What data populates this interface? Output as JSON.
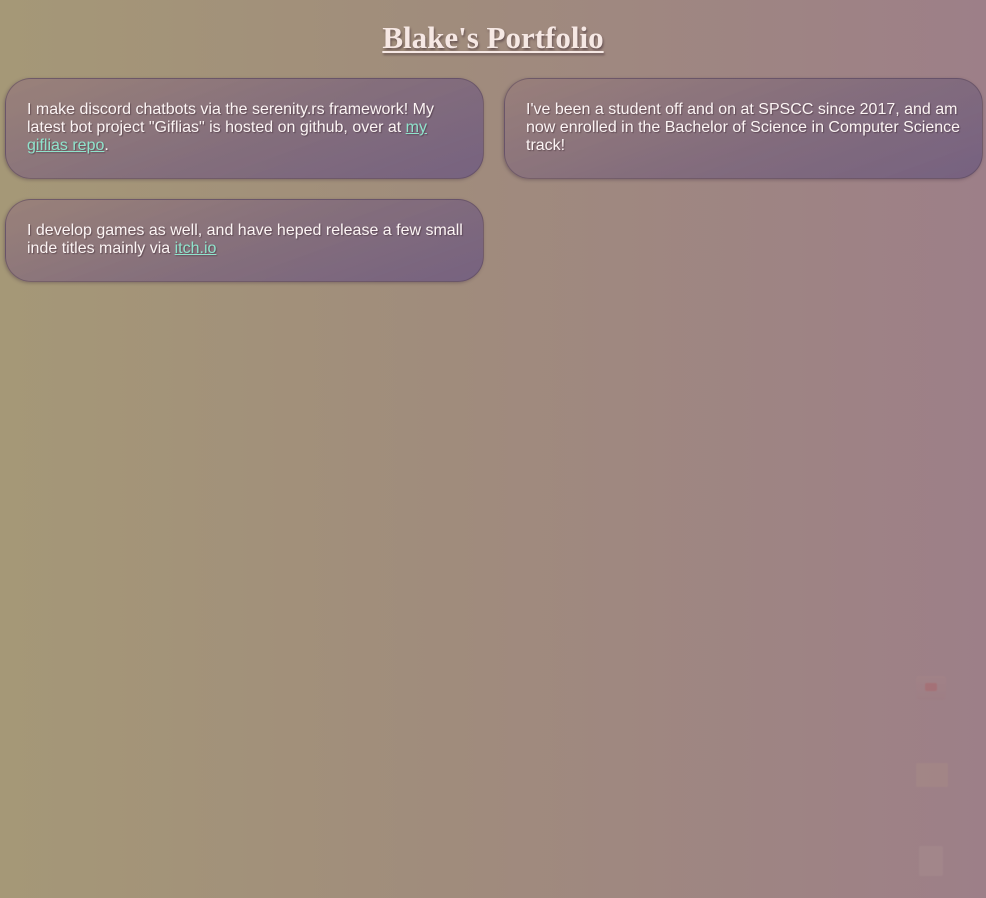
{
  "page": {
    "title": "Blake's Portfolio"
  },
  "cards": [
    {
      "text_before": "I make discord chatbots via the serenity.rs framework! My latest bot project \"Giflias\" is hosted on github, over at ",
      "link_text": "my giflias repo",
      "text_after": "."
    },
    {
      "text": "I've been a student off and on at SPSCC since 2017, and am now enrolled in the Bachelor of Science in Computer Science track!"
    },
    {
      "text_before": "I develop games as well, and have heped release a few small inde titles mainly via ",
      "link_text": "itch.io",
      "text_after": ""
    }
  ],
  "colors": {
    "link": "#8fe3cc",
    "title": "#f6e8e4",
    "card_text": "#fcf4f4"
  },
  "desktop_icons": [
    "app-shortcut-icon",
    "folder-icon",
    "file-icon"
  ]
}
